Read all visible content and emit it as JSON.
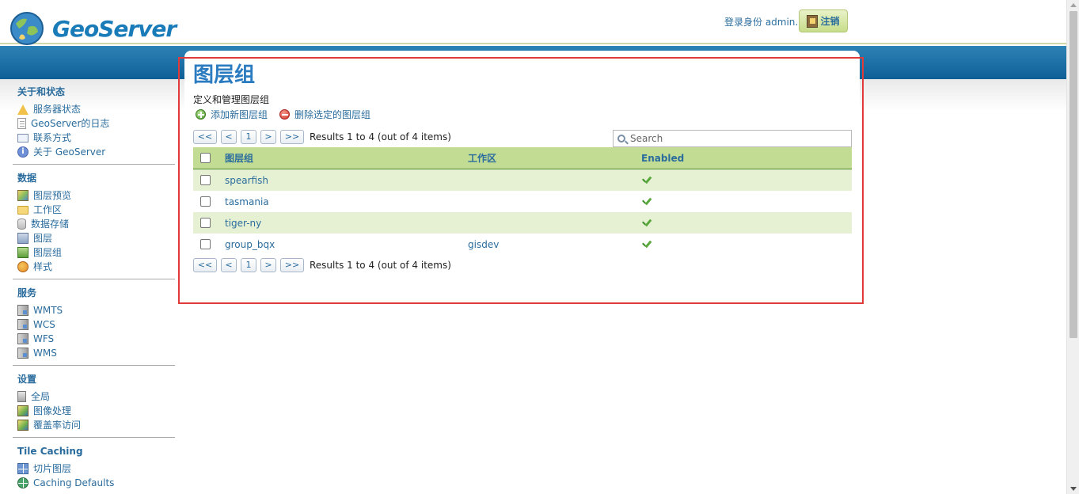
{
  "header": {
    "logo_text": "GeoServer",
    "login_text": "登录身份 admin.",
    "logout_label": "注销"
  },
  "sidebar": {
    "groups": [
      {
        "title": "关于和状态",
        "items": [
          {
            "label": "服务器状态",
            "icon": "warning-icon"
          },
          {
            "label": "GeoServer的日志",
            "icon": "document-icon"
          },
          {
            "label": "联系方式",
            "icon": "contact-card-icon"
          },
          {
            "label": "关于 GeoServer",
            "icon": "info-icon"
          }
        ]
      },
      {
        "title": "数据",
        "items": [
          {
            "label": "图层预览",
            "icon": "map-preview-icon"
          },
          {
            "label": "工作区",
            "icon": "folder-icon"
          },
          {
            "label": "数据存储",
            "icon": "database-icon"
          },
          {
            "label": "图层",
            "icon": "layer-icon"
          },
          {
            "label": "图层组",
            "icon": "layer-group-icon"
          },
          {
            "label": "样式",
            "icon": "style-palette-icon"
          }
        ]
      },
      {
        "title": "服务",
        "items": [
          {
            "label": "WMTS",
            "icon": "service-icon"
          },
          {
            "label": "WCS",
            "icon": "service-icon"
          },
          {
            "label": "WFS",
            "icon": "service-icon"
          },
          {
            "label": "WMS",
            "icon": "service-icon"
          }
        ]
      },
      {
        "title": "设置",
        "items": [
          {
            "label": "全局",
            "icon": "global-settings-icon"
          },
          {
            "label": "图像处理",
            "icon": "image-processing-icon"
          },
          {
            "label": "覆盖率访问",
            "icon": "coverage-access-icon"
          }
        ]
      },
      {
        "title": "Tile Caching",
        "items": [
          {
            "label": "切片图层",
            "icon": "tile-grid-icon"
          },
          {
            "label": "Caching Defaults",
            "icon": "globe-icon"
          }
        ]
      }
    ]
  },
  "main": {
    "title": "图层组",
    "description": "定义和管理图层组",
    "add_label": "添加新图层组",
    "remove_label": "删除选定的图层组",
    "pager": {
      "first": "<<",
      "prev": "<",
      "page": "1",
      "next": ">",
      "last": ">>",
      "info": "Results 1 to 4 (out of 4 items)"
    },
    "search": {
      "placeholder": "Search"
    },
    "table": {
      "columns": [
        "图层组",
        "工作区",
        "Enabled"
      ],
      "rows": [
        {
          "name": "spearfish",
          "workspace": "",
          "enabled": true
        },
        {
          "name": "tasmania",
          "workspace": "",
          "enabled": true
        },
        {
          "name": "tiger-ny",
          "workspace": "",
          "enabled": true
        },
        {
          "name": "group_bqx",
          "workspace": "gisdev",
          "enabled": true
        }
      ]
    }
  },
  "colors": {
    "brand_blue": "#1a7bb9",
    "header_band": "#0e5f96",
    "link": "#2a6c9d",
    "table_header": "#c3dc94",
    "row_alt": "#e6f1d3",
    "highlight_box": "#e13a3a"
  }
}
